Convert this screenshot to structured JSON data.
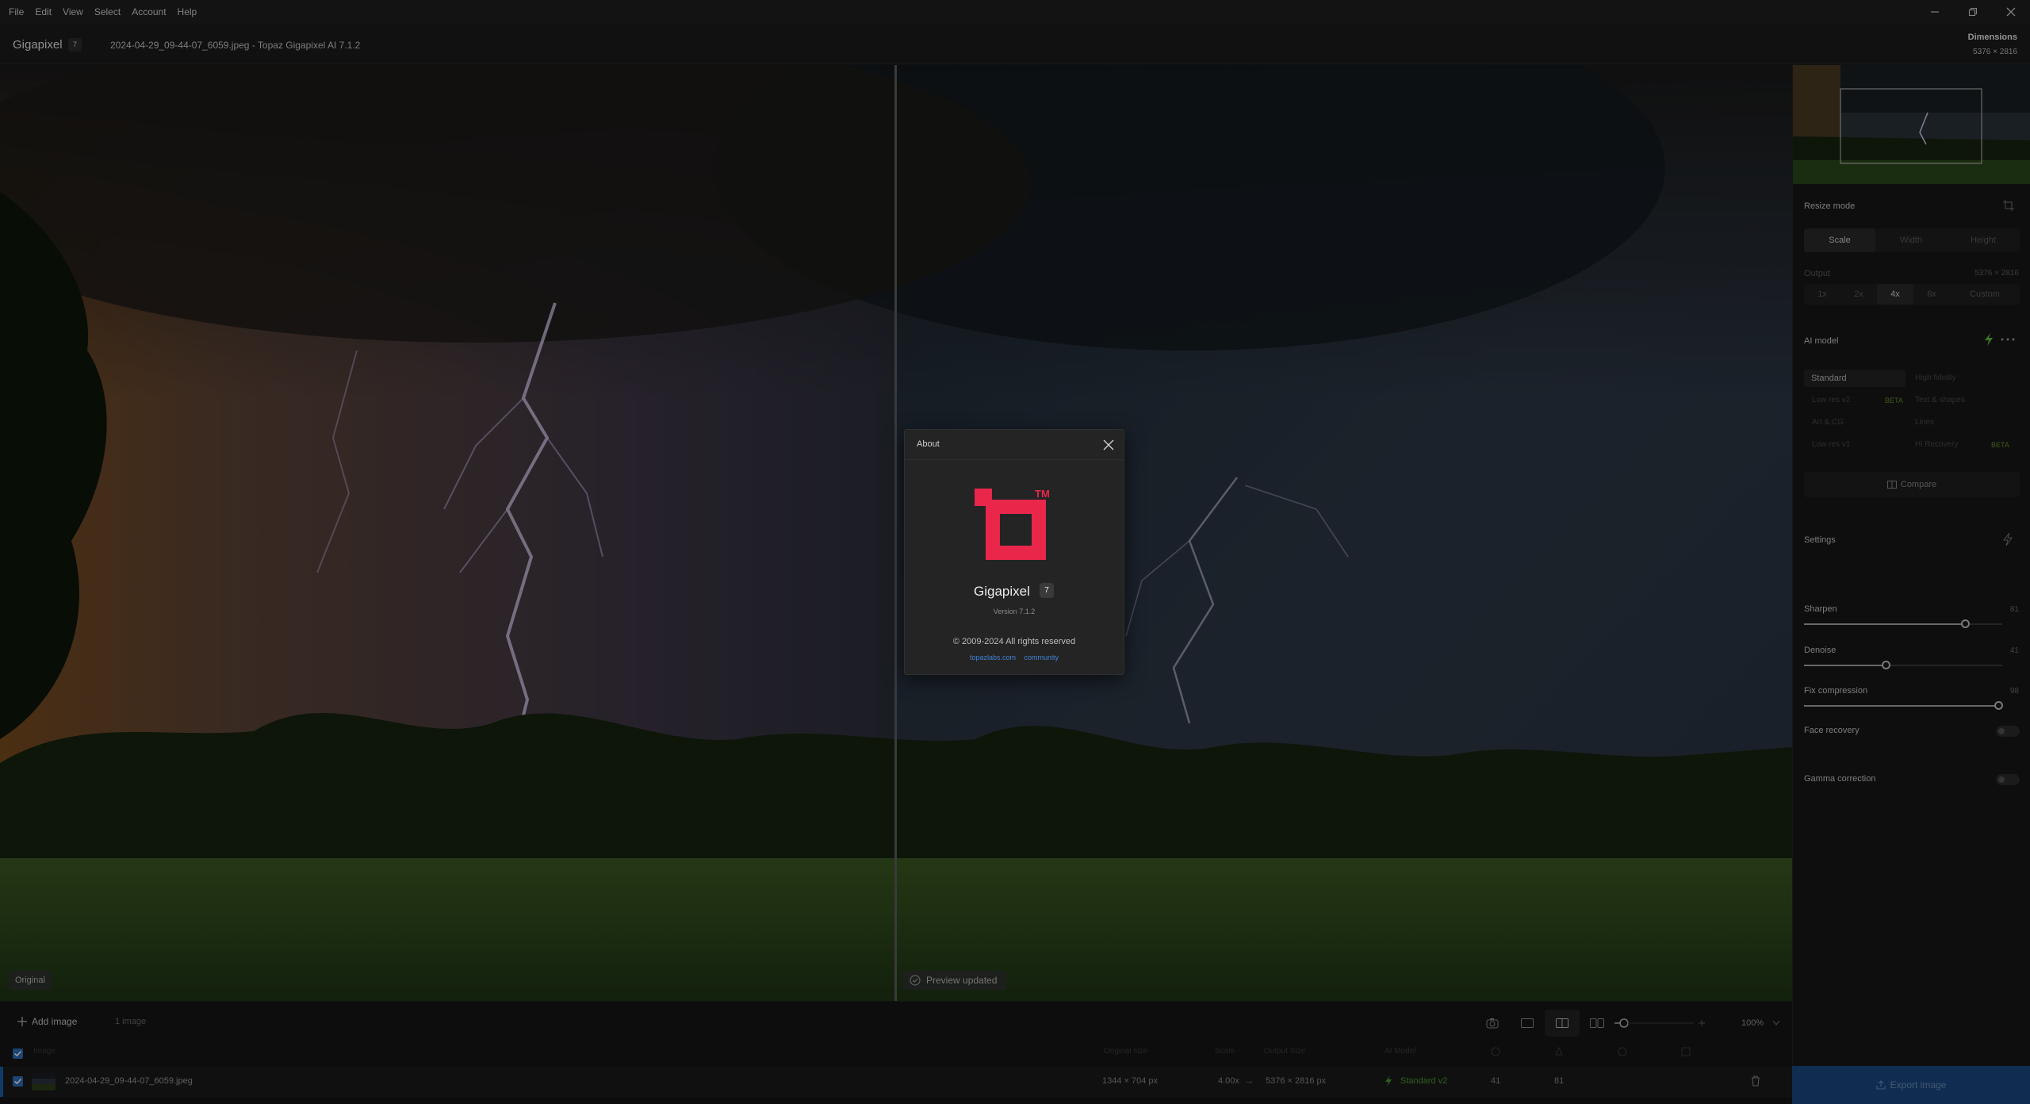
{
  "menu": [
    "File",
    "Edit",
    "View",
    "Select",
    "Account",
    "Help"
  ],
  "window_controls": {
    "minimize": "minimize-icon",
    "restore": "restore-icon",
    "close": "close-icon"
  },
  "titlebar": {
    "app_name": "Gigapixel",
    "app_version_badge": "7",
    "document_title": "2024-04-29_09-44-07_6059.jpeg - Topaz Gigapixel AI 7.1.2",
    "dimensions_label": "Dimensions",
    "dimensions_value": "5376 × 2816"
  },
  "preview": {
    "original_tag": "Original",
    "preview_updated": "Preview updated"
  },
  "right_panel": {
    "resize_mode_label": "Resize mode",
    "resize_modes": [
      "Scale",
      "Width",
      "Height"
    ],
    "resize_mode_selected": "Scale",
    "output_label": "Output",
    "output_value": "5376 × 2816",
    "scale_options": [
      "1x",
      "2x",
      "4x",
      "6x",
      "Custom"
    ],
    "scale_selected": "4x",
    "ai_model_label": "AI model",
    "models": [
      "Standard",
      "High fidelity",
      "Low res v2",
      "Text & shapes",
      "Art & CG",
      "Lines",
      "Low res v1",
      "Hi Recovery"
    ],
    "model_selected": "Standard",
    "beta_label": "BETA",
    "compare_label": "Compare",
    "settings_label": "Settings",
    "sliders": [
      {
        "label": "Sharpen",
        "value": 81,
        "max": 100
      },
      {
        "label": "Denoise",
        "value": 41,
        "max": 100
      },
      {
        "label": "Fix compression",
        "value": 98,
        "max": 100
      }
    ],
    "face_recovery_label": "Face recovery",
    "face_recovery_on": false,
    "gamma_correction_label": "Gamma correction",
    "gamma_correction_on": false
  },
  "tray": {
    "add_image": "Add image",
    "image_count": "1 image",
    "zoom": "100%",
    "columns": [
      "Image",
      "Original size",
      "Scale",
      "Output Size",
      "AI Model"
    ],
    "row": {
      "filename": "2024-04-29_09-44-07_6059.jpeg",
      "original_size": "1344 × 704 px",
      "scale": "4.00x",
      "arrow": "→",
      "output_size": "5376 × 2816 px",
      "model": "Standard v2",
      "sharpen": "41",
      "denoise": "81"
    }
  },
  "export_label": "Export image",
  "about": {
    "title": "About",
    "app_name": "Gigapixel",
    "badge": "7",
    "tm": "TM",
    "version": "Version 7.1.2",
    "copyright": "© 2009-2024 All rights reserved",
    "links": [
      "topazlabs.com",
      "community"
    ]
  },
  "colors": {
    "accent_logo": "#e8274b",
    "export_blue": "#1b4a84",
    "link_blue": "#3f82d6",
    "beta_green": "#6a8c2a"
  }
}
